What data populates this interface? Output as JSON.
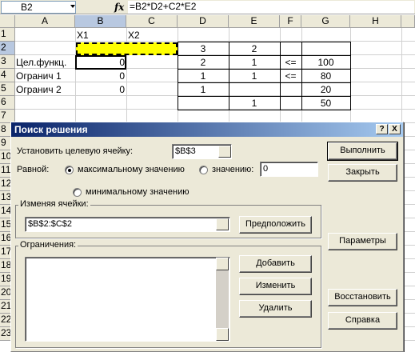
{
  "formula_bar": {
    "name_box": "B2",
    "fx_label": "fx",
    "formula": "=B2*D2+C2*E2"
  },
  "sheet": {
    "columns": [
      "A",
      "B",
      "C",
      "D",
      "E",
      "F",
      "G",
      "H"
    ],
    "rows": [
      "1",
      "2",
      "3",
      "4",
      "5",
      "6",
      "7",
      "8",
      "9",
      "10",
      "11",
      "12",
      "13",
      "14",
      "15",
      "16",
      "17",
      "18",
      "19",
      "20",
      "21",
      "22",
      "23"
    ],
    "active_cell": "B2",
    "highlight_color": "#ffff00",
    "cells": {
      "B1": "X1",
      "C1": "X2",
      "D2": "3",
      "E2": "2",
      "A3": "Цел.функц.",
      "B3": "0",
      "D3": "2",
      "E3": "1",
      "F3": "<=",
      "G3": "100",
      "A4": "Огранич 1",
      "B4": "0",
      "D4": "1",
      "E4": "1",
      "F4": "<=",
      "G4": "80",
      "A5": "Огранич 2",
      "B5": "0",
      "D5": "1",
      "G5": "20",
      "E6": "1",
      "G6": "50"
    }
  },
  "dialog": {
    "title": "Поиск решения",
    "help_btn": "?",
    "close_btn": "X",
    "target_label": "Установить целевую ячейку:",
    "target_value": "$B$3",
    "equal_label": "Равной:",
    "radio_max": "максимальному значению",
    "radio_value": "значению:",
    "value_input": "0",
    "radio_min": "минимальному значению",
    "changing_label": "Изменяя ячейки:",
    "changing_value": "$B$2:$C$2",
    "guess_btn": "Предположить",
    "constraints_label": "Ограничения:",
    "add_btn": "Добавить",
    "change_btn": "Изменить",
    "delete_btn": "Удалить",
    "solve_btn": "Выполнить",
    "close_dialog_btn": "Закрыть",
    "options_btn": "Параметры",
    "reset_btn": "Восстановить",
    "help_dialog_btn": "Справка",
    "selected_radio": "max"
  }
}
